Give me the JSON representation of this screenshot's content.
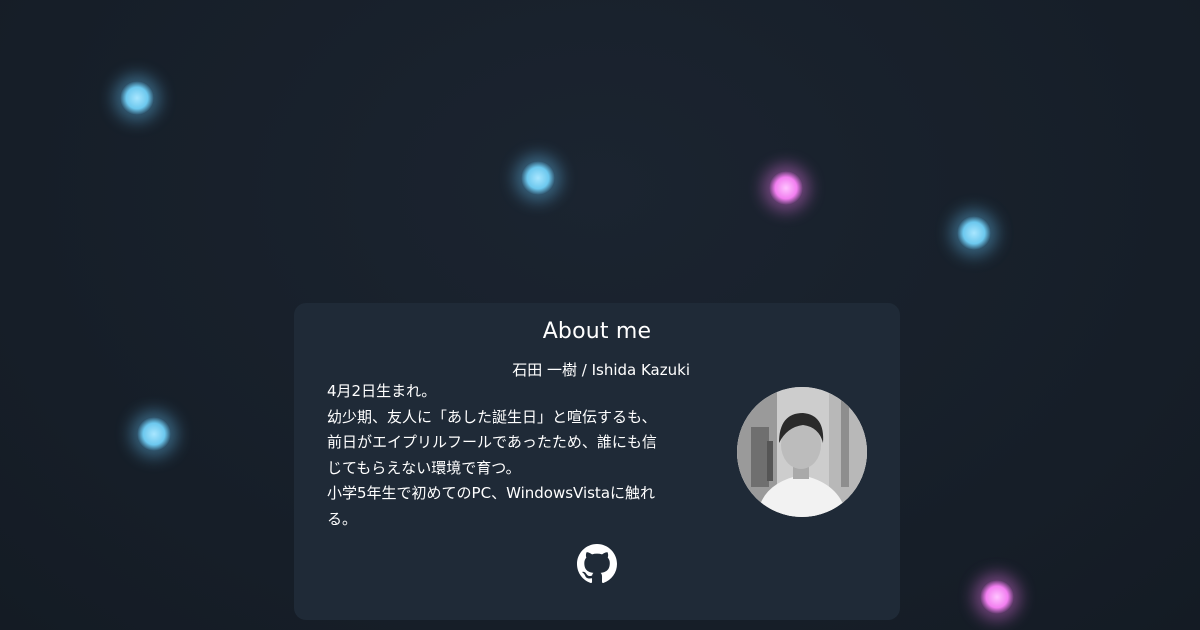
{
  "about": {
    "title": "About me",
    "name": "石田 一樹 / Ishida Kazuki",
    "bio_lines": [
      "4月2日生まれ。",
      "幼少期、友人に「あした誕生日」と喧伝するも、",
      "前日がエイプリルフールであったため、誰にも信",
      "じてもらえない環境で育つ。",
      "小学5年生で初めてのPC、WindowsVistaに触れ",
      "る。"
    ]
  },
  "links": {
    "github_icon": "github-icon"
  },
  "colors": {
    "background": "#18202b",
    "card": "#1f2a37",
    "orb_blue": "#7fd2f2",
    "orb_pink": "#f07ff0"
  }
}
